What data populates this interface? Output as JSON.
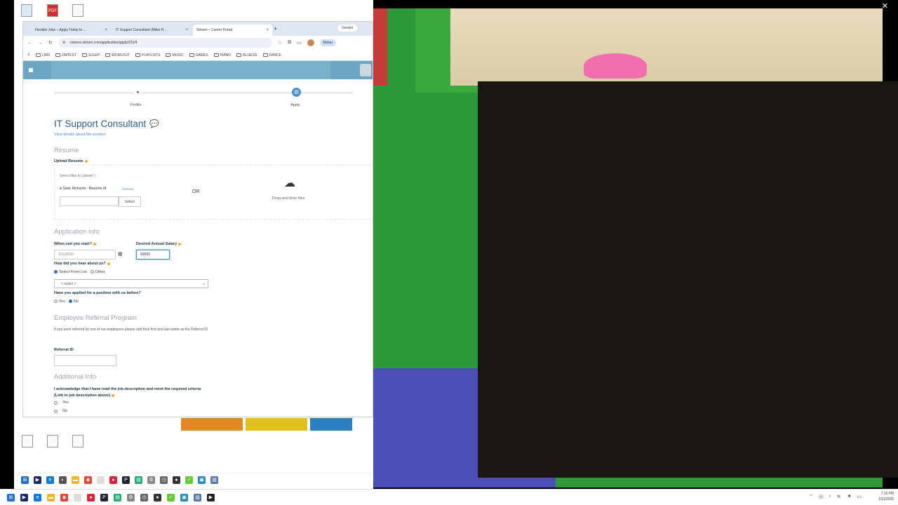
{
  "browser": {
    "tabs": [
      {
        "label": "Flexible Jobs – Apply Today to ..."
      },
      {
        "label": "IT Support Consultant (Miles H..."
      },
      {
        "label": "Striven – Career Portal"
      }
    ],
    "gemini_label": "Gemini",
    "url": "careers.striven.com/application/apply/201/4",
    "relaunch_label": "Relau",
    "bookmarks": [
      "LIMS",
      "DMTEST",
      "SLEEP",
      "WORKOUT",
      "PLAYLISTS",
      "MUSIC",
      "GAMES",
      "PIANO",
      "BLUESG",
      "DANCE"
    ]
  },
  "steps": {
    "profile": "Profile",
    "apply": "Apply"
  },
  "page": {
    "title": "IT Support Consultant",
    "view_details": "View details about the position"
  },
  "resume": {
    "section": "Resume",
    "upload_label": "Upload Resume",
    "select_files": "Select files to Upload",
    "file_name": "Sean Richards - Resume.rtf",
    "remove": "Remove",
    "select_btn": "Select",
    "or": "OR",
    "drag_drop": "Drag and drop files"
  },
  "app_info": {
    "section": "Application info",
    "start_label": "When can you start?",
    "start_value": "1/11/2026",
    "salary_label": "Desired Annual Salary",
    "salary_value": "50000",
    "hear_label": "How did you hear about us?",
    "hear_opt1": "Select From List",
    "hear_opt2": "Other",
    "select_placeholder": "< select >",
    "applied_label": "Have you applied for a position with us before?",
    "yes": "Yes",
    "no": "No"
  },
  "referral": {
    "section": "Employee Referral Program",
    "desc": "If you were referred by one of our employees please add their first and last name as the Referral ID",
    "id_label": "Referral ID"
  },
  "additional": {
    "section": "Additional Info",
    "ack": "I acknowledge that I have read the job description and meet the required criteria (Link to job description above)",
    "yes": "Yes",
    "no": "No"
  },
  "desktop_icons": [
    "Recycle Bin",
    "PDF",
    "Doc"
  ],
  "tray": {
    "time": "7:16 PM",
    "date": "1/11/2026"
  }
}
